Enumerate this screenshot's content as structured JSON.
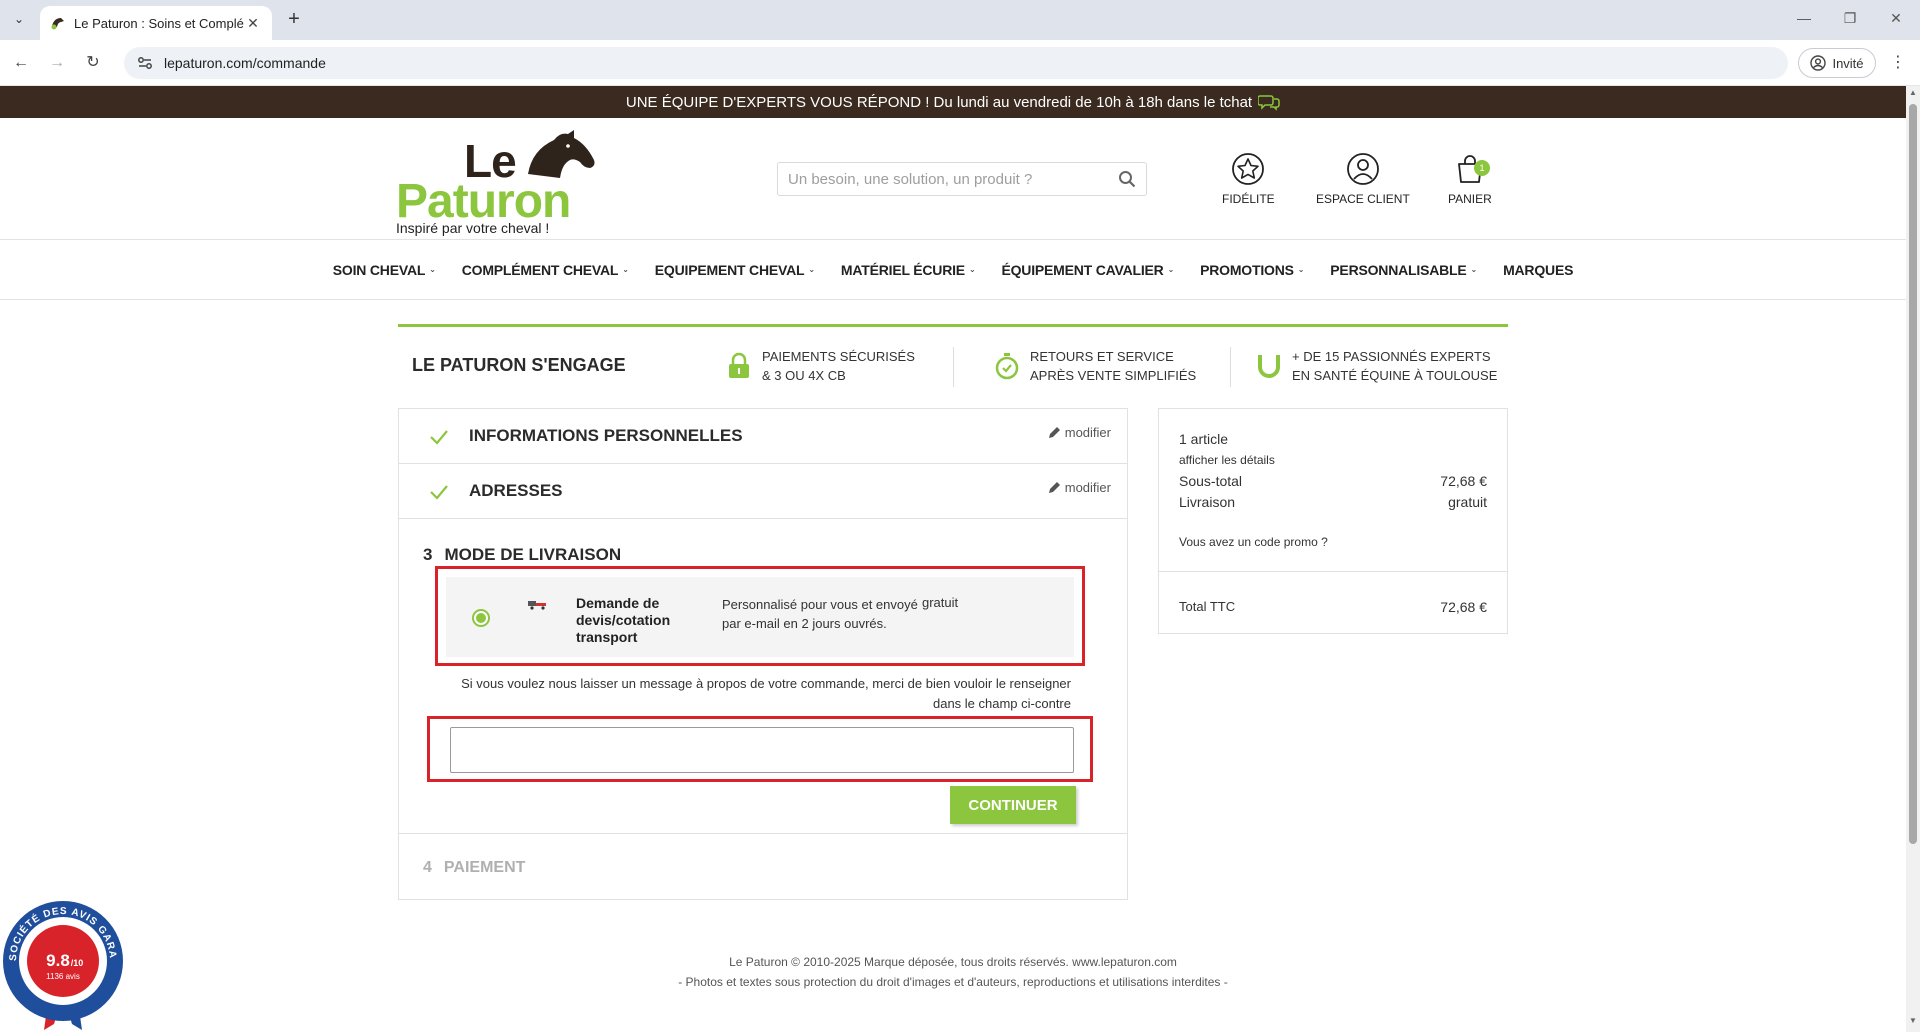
{
  "browser": {
    "tab_title": "Le Paturon : Soins et Complém",
    "url": "lepaturon.com/commande",
    "profile_label": "Invité"
  },
  "site": {
    "top_banner": "UNE ÉQUIPE D'EXPERTS VOUS RÉPOND ! Du lundi au vendredi de 10h à 18h dans le tchat",
    "logo_le": "Le",
    "logo_paturon": "Paturon",
    "logo_tagline": "Inspiré par votre cheval !",
    "search_placeholder": "Un besoin, une solution, un produit ?",
    "header_links": [
      {
        "label": "FIDÉLITE",
        "icon": "star-icon"
      },
      {
        "label": "ESPACE CLIENT",
        "icon": "user-icon"
      },
      {
        "label": "PANIER",
        "icon": "bag-icon",
        "badge": "1"
      }
    ],
    "menu": [
      "SOIN CHEVAL",
      "COMPLÉMENT CHEVAL",
      "EQUIPEMENT CHEVAL",
      "MATÉRIEL ÉCURIE",
      "ÉQUIPEMENT CAVALIER",
      "PROMOTIONS",
      "PERSONNALISABLE",
      "MARQUES"
    ],
    "menu_with_caret": [
      true,
      true,
      true,
      true,
      true,
      true,
      true,
      false
    ]
  },
  "engage": {
    "title": "LE PATURON S'ENGAGE",
    "items": [
      {
        "line1": "PAIEMENTS SÉCURISÉS",
        "line2": "& 3 OU 4X CB",
        "icon": "lock-icon"
      },
      {
        "line1": "RETOURS ET SERVICE",
        "line2": "APRÈS VENTE SIMPLIFIÉS",
        "icon": "timer-icon"
      },
      {
        "line1": "+ DE 15 PASSIONNÉS EXPERTS",
        "line2": "EN SANTÉ ÉQUINE À TOULOUSE",
        "icon": "horseshoe-icon"
      }
    ]
  },
  "checkout": {
    "step1": {
      "title": "INFORMATIONS PERSONNELLES",
      "edit": "modifier"
    },
    "step2": {
      "title": "ADRESSES",
      "edit": "modifier"
    },
    "step3": {
      "num": "3",
      "title": "MODE DE LIVRAISON",
      "carrier": {
        "name": "Demande de devis/cotation transport",
        "delay": "Personnalisé pour vous et envoyé par e-mail en 2 jours ouvrés.",
        "price": "gratuit"
      },
      "message_label": "Si vous voulez nous laisser un message à propos de votre commande, merci de bien vouloir le renseigner dans le champ ci-contre",
      "message_value": "",
      "continue_label": "CONTINUER"
    },
    "step4": {
      "num": "4",
      "title": "PAIEMENT"
    }
  },
  "summary": {
    "count": "1 article",
    "details_link": "afficher les détails",
    "subtotal_label": "Sous-total",
    "subtotal_value": "72,68 €",
    "shipping_label": "Livraison",
    "shipping_value": "gratuit",
    "promo_link": "Vous avez un code promo ?",
    "total_label": "Total TTC",
    "total_value": "72,68 €"
  },
  "footer": {
    "line1": "Le Paturon © 2010-2025 Marque déposée, tous droits réservés. www.lepaturon.com",
    "line2": "- Photos et textes sous protection du droit d'images et d'auteurs, reproductions et utilisations interdites -"
  },
  "review_badge": {
    "ring_text": "SOCIÉTÉ DES AVIS GARANTIS",
    "score": "9.8",
    "scale": "/10",
    "count": "1136 avis"
  },
  "colors": {
    "brand_green": "#8cc63f",
    "brand_brown": "#3a2a1f",
    "highlight_red": "#d8232a"
  }
}
